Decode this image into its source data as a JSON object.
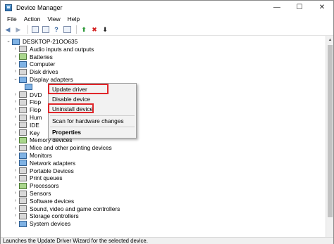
{
  "window": {
    "title": "Device Manager",
    "controls": {
      "minimize": "—",
      "maximize": "☐",
      "close": "✕"
    }
  },
  "menu": [
    "File",
    "Action",
    "View",
    "Help"
  ],
  "toolbar": {
    "icons": [
      "back-arrow-icon",
      "forward-arrow-icon",
      "properties-icon",
      "show-hidden-icon",
      "help-icon",
      "device-panel-icon",
      "update-driver-icon",
      "uninstall-icon",
      "scan-icon"
    ]
  },
  "tree": {
    "root": "DESKTOP-21OO635",
    "items": [
      {
        "label": "Audio inputs and outputs",
        "arrow": "›",
        "icon": "c-gray"
      },
      {
        "label": "Batteries",
        "arrow": "›",
        "icon": "c-green"
      },
      {
        "label": "Computer",
        "arrow": "›",
        "icon": "c-blue"
      },
      {
        "label": "Disk drives",
        "arrow": "›",
        "icon": "c-gray"
      },
      {
        "label": "Display adapters",
        "arrow": "⌄",
        "icon": "c-blue"
      },
      {
        "label": "",
        "arrow": "",
        "icon": ""
      },
      {
        "label": "DVD",
        "arrow": "›",
        "icon": "c-gray"
      },
      {
        "label": "Flop",
        "arrow": "›",
        "icon": "c-gray"
      },
      {
        "label": "Flop",
        "arrow": "›",
        "icon": "c-gray"
      },
      {
        "label": "Hum",
        "arrow": "›",
        "icon": "c-gray"
      },
      {
        "label": "IDE",
        "arrow": "›",
        "icon": "c-gray"
      },
      {
        "label": "Key",
        "arrow": "›",
        "icon": "c-gray"
      },
      {
        "label": "Memory devices",
        "arrow": "›",
        "icon": "c-green"
      },
      {
        "label": "Mice and other pointing devices",
        "arrow": "›",
        "icon": "c-gray"
      },
      {
        "label": "Monitors",
        "arrow": "›",
        "icon": "c-blue"
      },
      {
        "label": "Network adapters",
        "arrow": "›",
        "icon": "c-blue"
      },
      {
        "label": "Portable Devices",
        "arrow": "›",
        "icon": "c-gray"
      },
      {
        "label": "Print queues",
        "arrow": "›",
        "icon": "c-gray"
      },
      {
        "label": "Processors",
        "arrow": "›",
        "icon": "c-green"
      },
      {
        "label": "Sensors",
        "arrow": "›",
        "icon": "c-gray"
      },
      {
        "label": "Software devices",
        "arrow": "›",
        "icon": "c-gray"
      },
      {
        "label": "Sound, video and game controllers",
        "arrow": "›",
        "icon": "c-gray"
      },
      {
        "label": "Storage controllers",
        "arrow": "›",
        "icon": "c-gray"
      },
      {
        "label": "System devices",
        "arrow": "›",
        "icon": "c-blue"
      }
    ]
  },
  "context_menu": {
    "items": [
      {
        "label": "Update driver",
        "bold": false
      },
      {
        "label": "Disable device",
        "bold": false
      },
      {
        "label": "Uninstall device",
        "bold": false
      },
      {
        "label": "Scan for hardware changes",
        "bold": false
      },
      {
        "label": "Properties",
        "bold": true
      }
    ],
    "highlight_color": "#e0262a"
  },
  "statusbar": {
    "text": "Launches the Update Driver Wizard for the selected device."
  }
}
